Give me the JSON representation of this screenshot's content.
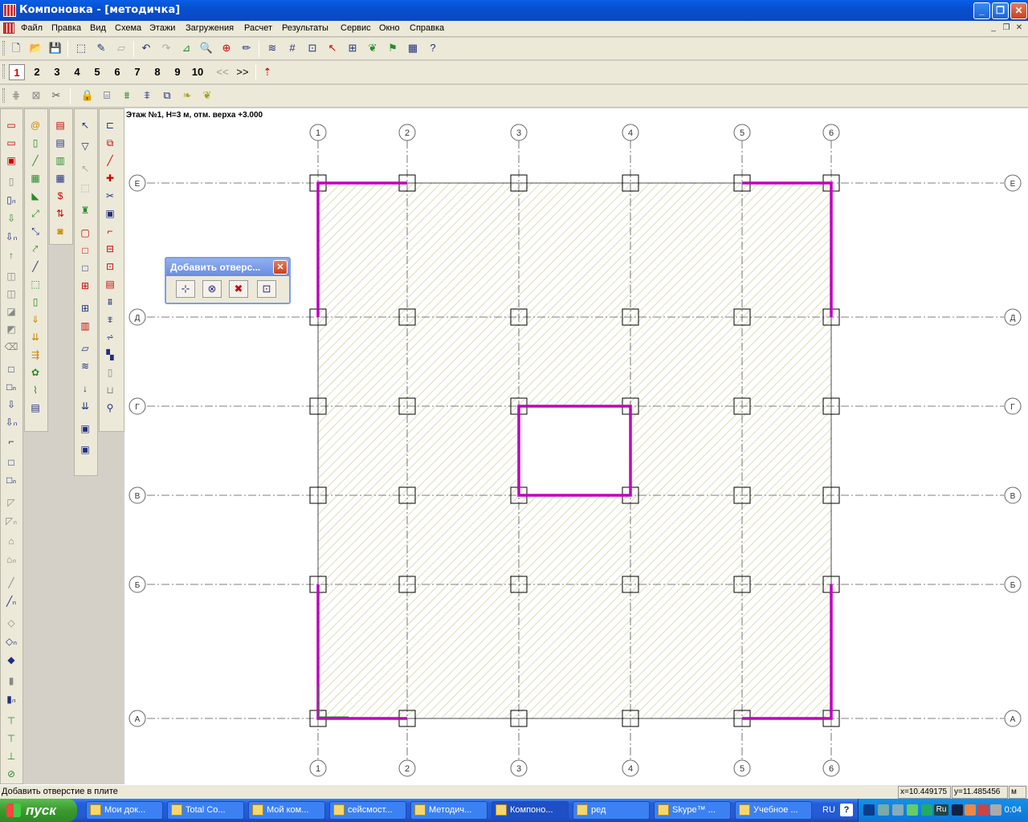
{
  "window": {
    "title": "Компоновка - [методичка]"
  },
  "menu": [
    "Файл",
    "Правка",
    "Вид",
    "Схема",
    "Этажи",
    "Загружения",
    "Расчет",
    "Результаты",
    "Сервис",
    "Окно",
    "Справка"
  ],
  "floor_tabs": {
    "numbers": [
      "1",
      "2",
      "3",
      "4",
      "5",
      "6",
      "7",
      "8",
      "9",
      "10"
    ],
    "active": "1",
    "prev": "<<",
    "next": ">>"
  },
  "canvas": {
    "floor_label": "Этаж №1, H=3 м, отм. верха +3.000",
    "axes_x": [
      "1",
      "2",
      "3",
      "4",
      "5",
      "6"
    ],
    "axes_y": [
      "Е",
      "Д",
      "Г",
      "В",
      "Б",
      "А"
    ],
    "colors": {
      "wall": "#c000c0",
      "hatch": "#c8c890",
      "grid": "#404040"
    }
  },
  "float_panel": {
    "title": "Добавить отверс...",
    "close": "✕"
  },
  "status": {
    "text": "Добавить отверстие в плите",
    "x": "x=10.449175",
    "y": "y=11.485456",
    "unit": "м"
  },
  "taskbar": {
    "start": "пуск",
    "tasks": [
      {
        "label": "Мои док..."
      },
      {
        "label": "Total Co..."
      },
      {
        "label": "Мой ком..."
      },
      {
        "label": "сейсмост..."
      },
      {
        "label": "Методич..."
      },
      {
        "label": "Компоно...",
        "active": true
      },
      {
        "label": "ред"
      },
      {
        "label": "Skype™ ..."
      },
      {
        "label": "Учебное ..."
      }
    ],
    "lang": "RU",
    "help": "?",
    "tray_lang": "Ru",
    "clock": "0:04"
  }
}
